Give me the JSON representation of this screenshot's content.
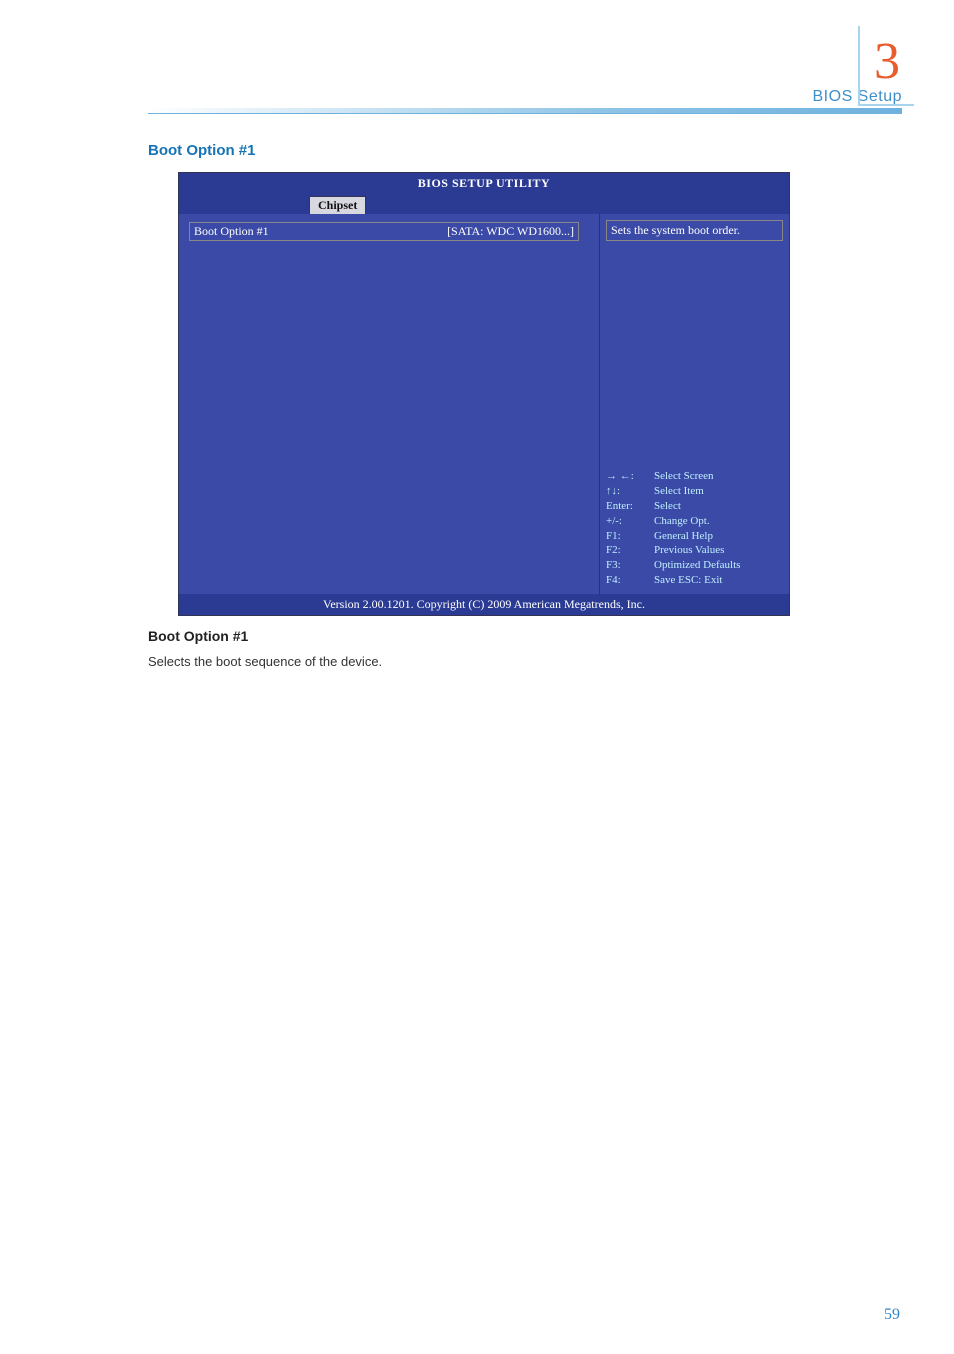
{
  "chapter_number": "3",
  "breadcrumb": "BIOS Setup",
  "page_heading": "Boot Option #1",
  "bios": {
    "title": "BIOS SETUP UTILITY",
    "active_tab": "Chipset",
    "row": {
      "label": "Boot Option #1",
      "value": "[SATA: WDC WD1600...]"
    },
    "help_top": "Sets the system boot order.",
    "keys": [
      {
        "k": "→ ←:",
        "d": "Select Screen"
      },
      {
        "k": "↑↓:",
        "d": "Select Item"
      },
      {
        "k": "Enter:",
        "d": "Select"
      },
      {
        "k": "+/-:",
        "d": "Change Opt."
      },
      {
        "k": "F1:",
        "d": "General Help"
      },
      {
        "k": "F2:",
        "d": "Previous Values"
      },
      {
        "k": "F3:",
        "d": "Optimized Defaults"
      },
      {
        "k": "F4:",
        "d": "Save   ESC: Exit"
      }
    ],
    "footer": "Version 2.00.1201. Copyright (C) 2009 American Megatrends, Inc."
  },
  "subsection_title": "Boot Option #1",
  "subsection_body": "Selects the boot sequence of the device.",
  "page_number": "59"
}
